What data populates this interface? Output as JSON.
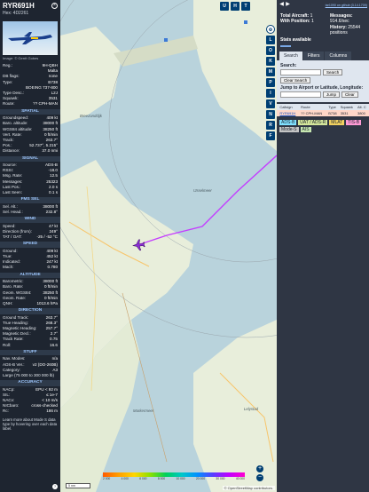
{
  "info": {
    "callsign": "RYR691H",
    "hex": "Hex: 4D2261",
    "photo_credit": "Image: © Gerrit Gobes",
    "basic": [
      {
        "k": "Reg.:",
        "v": "9H-QBH"
      },
      {
        "k": "",
        "v": "Malta"
      },
      {
        "k": "DB flags:",
        "v": "none"
      },
      {
        "k": "Type:",
        "v": "B738"
      },
      {
        "k": "",
        "v": "BOEING 737-800"
      },
      {
        "k": "Type Desc.:",
        "v": "L2J"
      },
      {
        "k": "Squawk:",
        "v": "3531"
      },
      {
        "k": "Route:",
        "v": "?? CPH-MAN"
      }
    ],
    "sections": [
      {
        "title": "SPATIAL",
        "rows": [
          {
            "k": "Groundspeed:",
            "v": "409 kt"
          },
          {
            "k": "Baro. altitude:",
            "v": "38000 ft"
          },
          {
            "k": "WGS84 altitude:",
            "v": "38250 ft"
          },
          {
            "k": "Vert. Rate:",
            "v": "0 ft/min"
          },
          {
            "k": "Track:",
            "v": "263.7°"
          },
          {
            "k": "Pos.:",
            "v": "52.737°, 5.215°"
          },
          {
            "k": "Distance:",
            "v": "37.0 nmi"
          }
        ]
      },
      {
        "title": "SIGNAL",
        "rows": [
          {
            "k": "Source:",
            "v": "ADS-B"
          },
          {
            "k": "RSSI:",
            "v": "-18.0"
          },
          {
            "k": "Msg. Rate:",
            "v": "12.5"
          },
          {
            "k": "Messages:",
            "v": "25323"
          },
          {
            "k": "Last Pos.:",
            "v": "2.0 s"
          },
          {
            "k": "Last Seen:",
            "v": "0.1 s"
          }
        ]
      },
      {
        "title": "FMS SEL",
        "rows": [
          {
            "k": "Sel. Alt.:",
            "v": "38000 ft"
          },
          {
            "k": "Sel. Head.:",
            "v": "232.8°"
          }
        ]
      },
      {
        "title": "WIND",
        "rows": [
          {
            "k": "Speed:",
            "v": "47 kt"
          },
          {
            "k": "Direction (from):",
            "v": "249°"
          },
          {
            "k": "TAT / OAT:",
            "v": "-25 / -52 °C"
          }
        ]
      },
      {
        "title": "SPEED",
        "rows": [
          {
            "k": "Ground:",
            "v": "409 kt"
          },
          {
            "k": "True:",
            "v": "452 kt"
          },
          {
            "k": "Indicated:",
            "v": "247 kt"
          },
          {
            "k": "Mach:",
            "v": "0.780"
          }
        ]
      },
      {
        "title": "ALTITUDE",
        "rows": [
          {
            "k": "Barometric:",
            "v": "38000 ft"
          },
          {
            "k": "Baro. Rate:",
            "v": "0 ft/min"
          },
          {
            "k": "Geom. WGS84:",
            "v": "38250 ft"
          },
          {
            "k": "Geom. Rate:",
            "v": "0 ft/min"
          },
          {
            "k": "QNH:",
            "v": "1013.6 hPa"
          }
        ]
      },
      {
        "title": "DIRECTION",
        "rows": [
          {
            "k": "Ground Track:",
            "v": "263.7°"
          },
          {
            "k": "True Heading:",
            "v": "268.3°"
          },
          {
            "k": "Magnetic Heading:",
            "v": "257.7°"
          },
          {
            "k": "Magnetic Decl.:",
            "v": "2.7°"
          },
          {
            "k": "Track Rate:",
            "v": "0.75"
          },
          {
            "k": "Roll:",
            "v": "16.6"
          }
        ]
      },
      {
        "title": "STUFF",
        "rows": [
          {
            "k": "Nav. Modes:",
            "v": "n/a"
          },
          {
            "k": "ADS-B Ver.:",
            "v": "v2 (DO-260B)"
          },
          {
            "k": "Category:",
            "v": "A3"
          },
          {
            "k": "Large (75 000 to 300 000 lb)",
            "v": ""
          }
        ]
      },
      {
        "title": "ACCURACY",
        "rows": [
          {
            "k": "NACp:",
            "v": "EPU < 92 m"
          },
          {
            "k": "SIL:",
            "v": "≤ 1e-7"
          },
          {
            "k": "NACv:",
            "v": "< 10 m/s"
          },
          {
            "k": "NICbaro:",
            "v": "cross-checked"
          },
          {
            "k": "Rc:",
            "v": "186 m"
          }
        ]
      }
    ],
    "note": "Learn more about Mode S data type by hovering over each data label."
  },
  "map": {
    "places": [
      {
        "name": "Breezanddijk",
        "cls": "p1"
      },
      {
        "name": "IJsselmeer",
        "cls": "p2"
      },
      {
        "name": "Markermeer",
        "cls": "p3"
      },
      {
        "name": "Lelystad",
        "cls": "p4"
      }
    ],
    "top_buttons": [
      "U",
      "H",
      "T"
    ],
    "side_buttons": [
      "L",
      "O",
      "K",
      "M",
      "P",
      "I",
      "V",
      "N",
      "R",
      "F"
    ],
    "zoom_in": "+",
    "zoom_out": "−",
    "scale_label": "5 nm",
    "alt_ticks": [
      "2 000",
      "4 000",
      "6 000",
      "8 000",
      "10 000",
      "20 000",
      "30 000",
      "40 000"
    ],
    "attribution": "© OpenStreetMap contributors."
  },
  "side": {
    "version_link": "tar1090 on github (3.14.1709)",
    "total_label": "Total Aircraft:",
    "total_value": "1",
    "withpos_label": "With Position:",
    "withpos_value": "1",
    "messages_label": "Messages:",
    "messages_value": "914.6/sec",
    "history_label": "History:",
    "history_value": "25544 positions",
    "stats_available": "Stats available",
    "tabs": [
      "Search",
      "Filters",
      "Columns"
    ],
    "search_label": "Search:",
    "search_button": "Search",
    "clear_search": "Clear Search",
    "jump_label": "Jump to Airport or Latitude, Longitude:",
    "jump_button": "Jump",
    "clear_button": "Clear",
    "table_headers": [
      "",
      "Callsign",
      "Route",
      "Type",
      "Squawk",
      "Alt. C"
    ],
    "table_rows": [
      [
        "",
        "RYR691H",
        "?? CPH-MAN",
        "B738",
        "3531",
        "3800"
      ]
    ],
    "legend": [
      {
        "label": "ADS-B",
        "color": "#7fe0ff"
      },
      {
        "label": "UAT / ADS-R",
        "color": "#d4e69b"
      },
      {
        "label": "MLAT",
        "color": "#f0d060"
      },
      {
        "label": "TIS-B",
        "color": "#ff9bd6"
      },
      {
        "label": "Mode-S",
        "color": "#c5c5c5"
      },
      {
        "label": "AIS",
        "color": "#c6e6b0"
      }
    ]
  }
}
